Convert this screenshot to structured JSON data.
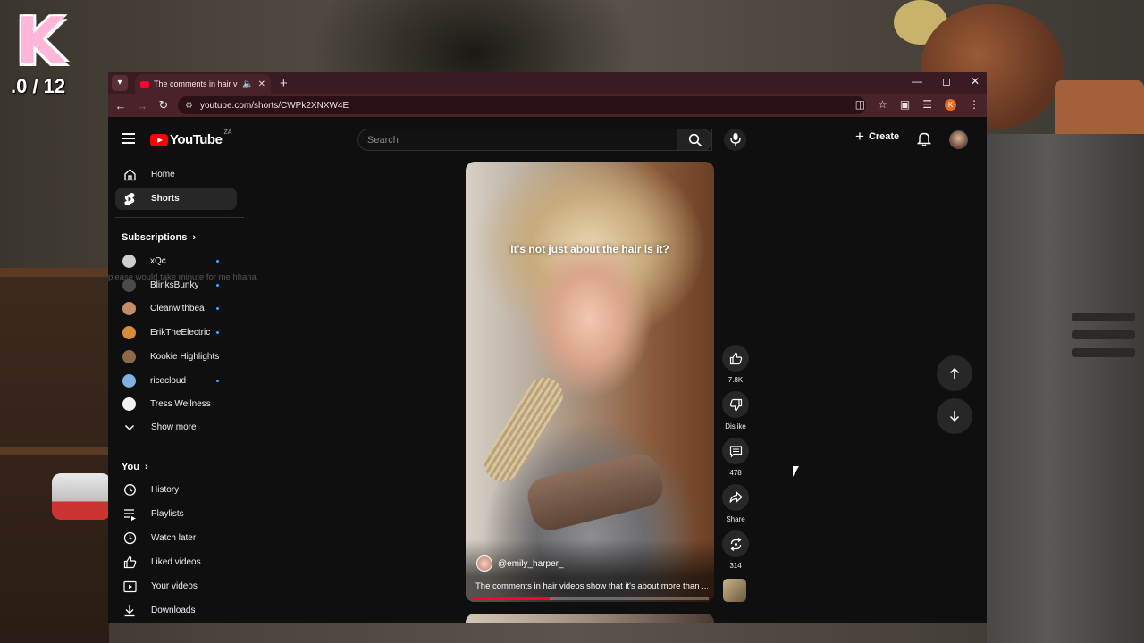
{
  "overlay": {
    "logo_letter": "K",
    "counter": ".0 / 12"
  },
  "browser": {
    "tab_title": "The comments in hair video",
    "url": "youtube.com/shorts/CWPk2XNXW4E",
    "profile_initial": "K"
  },
  "youtube": {
    "logo_text": "YouTube",
    "country_code": "ZA",
    "search_placeholder": "Search",
    "create_label": "Create"
  },
  "sidebar": {
    "main": [
      {
        "label": "Home"
      },
      {
        "label": "Shorts"
      }
    ],
    "subscriptions_title": "Subscriptions",
    "subscriptions": [
      {
        "label": "xQc",
        "color": "#cfcfcf"
      },
      {
        "label": "BlinksBunky",
        "color": "#4a4a4a"
      },
      {
        "label": "Cleanwithbea",
        "color": "#c48d6a"
      },
      {
        "label": "ErikTheElectric",
        "color": "#d98a3a"
      },
      {
        "label": "Kookie Highlights",
        "color": "#8b6a4a"
      },
      {
        "label": "ricecloud",
        "color": "#7fb2e0"
      },
      {
        "label": "Tress Wellness",
        "color": "#f2f2f2"
      }
    ],
    "show_more": "Show more",
    "you_title": "You",
    "you": [
      {
        "label": "History"
      },
      {
        "label": "Playlists"
      },
      {
        "label": "Watch later"
      },
      {
        "label": "Liked videos"
      },
      {
        "label": "Your videos"
      },
      {
        "label": "Downloads"
      }
    ],
    "ghost_text": "please would take minute for me hhaha"
  },
  "short": {
    "caption": "It's not just about the hair is it?",
    "channel": "@emily_harper_",
    "title": "The comments in hair videos show that it's about more than ...",
    "progress": 0.33
  },
  "actions": {
    "likes": "7.8K",
    "dislike": "Dislike",
    "comments": "478",
    "share": "Share",
    "remix": "314"
  },
  "colors": {
    "accent": "#ff0033",
    "tab_bar": "#3a1b21",
    "address_bar": "#4a222a"
  }
}
